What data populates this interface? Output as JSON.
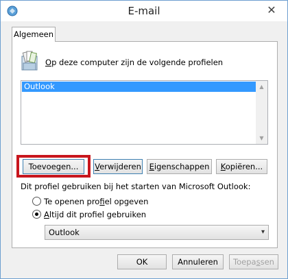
{
  "window": {
    "title": "E-mail",
    "close_glyph": "✕"
  },
  "tabs": [
    {
      "label": "Algemeen"
    }
  ],
  "intro": {
    "prefix_underlined": "O",
    "text_rest": "p deze computer zijn de volgende profielen"
  },
  "profiles": {
    "items": [
      "Outlook"
    ],
    "selected_index": 0
  },
  "buttons": {
    "add": {
      "label": "Toevoegen..."
    },
    "remove": {
      "prefix": "V",
      "rest": "erwijderen"
    },
    "properties": {
      "prefix": "E",
      "rest": "igenschappen"
    },
    "copy": {
      "prefix": "K",
      "rest": "opiëren..."
    }
  },
  "startup": {
    "label": "Dit profiel gebruiken bij het starten van Microsoft Outlook:",
    "option_prompt": {
      "pre": "Te openen pro",
      "u": "f",
      "post": "iel opgeven",
      "checked": false
    },
    "option_always": {
      "pre": "",
      "u": "A",
      "post": "ltijd dit profiel gebruiken",
      "checked": true
    },
    "selected_profile": "Outlook"
  },
  "footer": {
    "ok": "OK",
    "cancel": "Annuleren",
    "apply_pre": "Toepa",
    "apply_u": "s",
    "apply_post": "sen"
  },
  "colors": {
    "highlight_annotation": "#c8161d",
    "selection": "#3399ff"
  }
}
